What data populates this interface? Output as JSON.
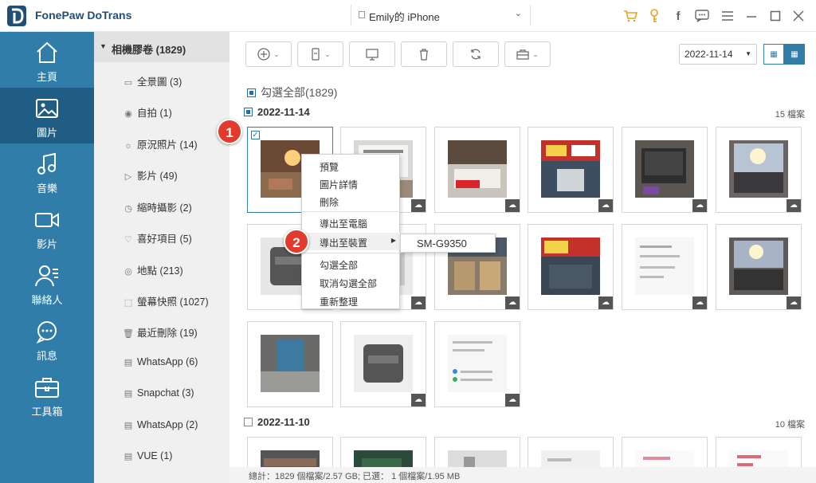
{
  "app": {
    "title": "FonePaw DoTrans",
    "device_name": "Emily的 iPhone",
    "accent": "#2f7da8",
    "logo_icon": "dotrans-logo-icon"
  },
  "titlebar_icons": [
    "cart-icon",
    "key-icon",
    "facebook-icon",
    "feedback-icon",
    "menu-icon",
    "minimize-icon",
    "maximize-icon",
    "close-icon"
  ],
  "sidebar": {
    "items": [
      {
        "label": "主頁",
        "icon": "home-icon"
      },
      {
        "label": "圖片",
        "icon": "photo-icon"
      },
      {
        "label": "音樂",
        "icon": "music-icon"
      },
      {
        "label": "影片",
        "icon": "video-icon"
      },
      {
        "label": "聯絡人",
        "icon": "contacts-icon"
      },
      {
        "label": "訊息",
        "icon": "messages-icon"
      },
      {
        "label": "工具箱",
        "icon": "toolbox-icon"
      }
    ],
    "active_index": 1
  },
  "albums": {
    "header": "相機膠卷 (1829)",
    "items": [
      {
        "label": "全景圖 (3)",
        "icon": "panorama-icon"
      },
      {
        "label": "自拍 (1)",
        "icon": "selfie-icon"
      },
      {
        "label": "原況照片 (14)",
        "icon": "live-photo-icon"
      },
      {
        "label": "影片 (49)",
        "icon": "video-icon"
      },
      {
        "label": "縮時攝影 (2)",
        "icon": "timelapse-icon"
      },
      {
        "label": "喜好項目 (5)",
        "icon": "heart-icon"
      },
      {
        "label": "地點 (213)",
        "icon": "location-icon"
      },
      {
        "label": "螢幕快照 (1027)",
        "icon": "screenshot-icon"
      },
      {
        "label": "最近刪除 (19)",
        "icon": "trash-icon"
      },
      {
        "label": "WhatsApp (6)",
        "icon": "album-icon"
      },
      {
        "label": "Snapchat (3)",
        "icon": "album-icon"
      },
      {
        "label": "WhatsApp (2)",
        "icon": "album-icon"
      },
      {
        "label": "VUE (1)",
        "icon": "album-icon"
      }
    ]
  },
  "toolbar": {
    "buttons": [
      "add-icon",
      "export-device-icon",
      "export-pc-icon",
      "delete-icon",
      "refresh-icon",
      "toolbox-icon"
    ],
    "date": "2022-11-14"
  },
  "select_all": "勾選全部(1829)",
  "groups": [
    {
      "date": "2022-11-14",
      "count": "15 檔案"
    },
    {
      "date": "2022-11-10",
      "count": "10 檔案"
    }
  ],
  "badges": [
    "1",
    "2"
  ],
  "context_menu": {
    "items": [
      "預覽",
      "圖片詳情",
      "刪除",
      "導出至電腦",
      "導出至裝置",
      "勾選全部",
      "取消勾選全部",
      "重新整理"
    ],
    "submenu": "SM-G9350"
  },
  "status": "總計：1829 個檔案/2.57 GB; 已選： 1 個檔案/1.95 MB"
}
